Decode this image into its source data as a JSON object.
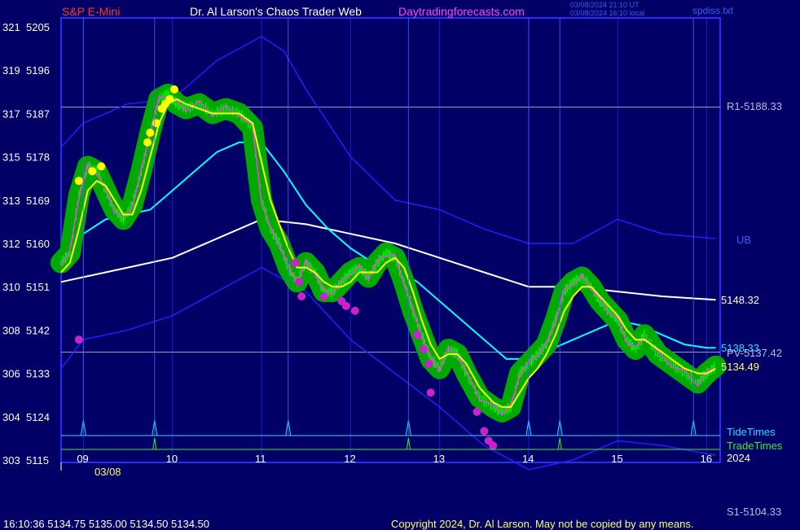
{
  "header": {
    "instrument": "S&P E-Mini",
    "title": "Dr. Al Larson's Chaos Trader Web",
    "site": "Daytradingforecasts.com",
    "utc_time": "03/08/2024 21:10 UT",
    "local_time": "03/08/2024 16:10 local",
    "file": "spdiss.txt"
  },
  "colors": {
    "background": "#000066",
    "frame": "#2a2aff",
    "price": "#00ff00",
    "glow": "#00aa00",
    "ema_fast": "#ffff00",
    "ema_mid": "#00ffff",
    "ema_slow": "#ffffff",
    "bands": "#2020ff",
    "magenta": "#ff33ff",
    "pivot_line": "#9999cc"
  },
  "chart_data": {
    "type": "line",
    "y_left_ticks": [
      "321",
      "319",
      "317",
      "315",
      "313",
      "312",
      "310",
      "308",
      "306",
      "304",
      "303"
    ],
    "y_right_ticks": [
      "5205",
      "5196",
      "5187",
      "5178",
      "5169",
      "5160",
      "5151",
      "5142",
      "5133",
      "5124",
      "5115"
    ],
    "ylim": [
      5115,
      5205
    ],
    "x_ticks": [
      "09",
      "10",
      "11",
      "12",
      "13",
      "14",
      "15",
      "16"
    ],
    "date_label": "03/08",
    "levels": [
      {
        "name": "R1",
        "label": "R1-5188.33",
        "value": 5188.33
      },
      {
        "name": "PV",
        "label": "PV-5137.42",
        "value": 5137.42
      },
      {
        "name": "S1",
        "label": "S1-5104.33",
        "value": 5104.33
      }
    ],
    "right_labels": {
      "ub": "UB",
      "slow_ema": "5148.32",
      "mid_ema": "5138.33",
      "last": "5134.49",
      "tide": "TideTimes",
      "trade": "TradeTimes",
      "year": "2024"
    },
    "x_range": [
      8.75,
      16.15
    ],
    "series": [
      {
        "kind": "price",
        "x": [
          8.75,
          8.85,
          8.95,
          9.05,
          9.15,
          9.25,
          9.35,
          9.45,
          9.55,
          9.65,
          9.75,
          9.85,
          9.95,
          10.05,
          10.15,
          10.3,
          10.45,
          10.6,
          10.75,
          10.9,
          11.0,
          11.1,
          11.2,
          11.3,
          11.4,
          11.5,
          11.6,
          11.7,
          11.8,
          11.9,
          12.0,
          12.1,
          12.2,
          12.3,
          12.4,
          12.5,
          12.6,
          12.7,
          12.8,
          12.9,
          13.0,
          13.1,
          13.2,
          13.3,
          13.45,
          13.6,
          13.7,
          13.8,
          13.9,
          14.0,
          14.1,
          14.2,
          14.3,
          14.4,
          14.5,
          14.6,
          14.7,
          14.8,
          14.9,
          15.0,
          15.1,
          15.2,
          15.3,
          15.45,
          15.6,
          15.75,
          15.9,
          16.0,
          16.1
        ],
        "y": [
          5156,
          5158,
          5170,
          5176,
          5175,
          5171,
          5167,
          5165,
          5168,
          5175,
          5183,
          5190,
          5191,
          5189,
          5188,
          5189,
          5187,
          5188,
          5187,
          5184,
          5169,
          5163,
          5160,
          5155,
          5152,
          5156,
          5154,
          5150,
          5150,
          5152,
          5154,
          5155,
          5153,
          5156,
          5158,
          5157,
          5152,
          5146,
          5141,
          5136,
          5134,
          5138,
          5137,
          5133,
          5128,
          5126,
          5125,
          5126,
          5133,
          5135,
          5137,
          5139,
          5144,
          5150,
          5152,
          5153,
          5151,
          5148,
          5146,
          5144,
          5140,
          5138,
          5141,
          5137,
          5135,
          5133,
          5131,
          5133,
          5134.5
        ]
      },
      {
        "kind": "ema_fast",
        "x": [
          8.75,
          8.85,
          8.95,
          9.05,
          9.15,
          9.25,
          9.35,
          9.45,
          9.55,
          9.65,
          9.75,
          9.85,
          9.95,
          10.05,
          10.15,
          10.3,
          10.45,
          10.6,
          10.75,
          10.9,
          11.0,
          11.1,
          11.2,
          11.3,
          11.4,
          11.5,
          11.6,
          11.7,
          11.8,
          11.9,
          12.0,
          12.1,
          12.2,
          12.3,
          12.4,
          12.5,
          12.6,
          12.7,
          12.8,
          12.9,
          13.0,
          13.1,
          13.2,
          13.3,
          13.45,
          13.6,
          13.7,
          13.8,
          13.9,
          14.0,
          14.1,
          14.2,
          14.3,
          14.4,
          14.5,
          14.6,
          14.7,
          14.8,
          14.9,
          15.0,
          15.1,
          15.2,
          15.3,
          15.45,
          15.6,
          15.75,
          15.9,
          16.0,
          16.1
        ],
        "y": [
          5154,
          5156,
          5163,
          5171,
          5173,
          5172,
          5169,
          5166,
          5166,
          5171,
          5178,
          5185,
          5189,
          5190,
          5189,
          5188,
          5187,
          5187,
          5187,
          5185,
          5177,
          5169,
          5164,
          5159,
          5155,
          5155,
          5154,
          5152,
          5151,
          5151,
          5152,
          5154,
          5154,
          5154,
          5156,
          5157,
          5155,
          5150,
          5144,
          5139,
          5136,
          5137,
          5137,
          5135,
          5130,
          5127,
          5126,
          5126,
          5129,
          5132,
          5134,
          5137,
          5141,
          5146,
          5149,
          5151,
          5151,
          5149,
          5147,
          5145,
          5142,
          5140,
          5140,
          5138,
          5136,
          5134,
          5133,
          5133,
          5134
        ]
      },
      {
        "kind": "ema_mid",
        "x": [
          8.75,
          9.0,
          9.25,
          9.5,
          9.75,
          10.0,
          10.25,
          10.5,
          10.75,
          11.0,
          11.25,
          11.5,
          11.75,
          12.0,
          12.25,
          12.5,
          12.75,
          13.0,
          13.25,
          13.5,
          13.75,
          14.0,
          14.25,
          14.5,
          14.75,
          15.0,
          15.25,
          15.5,
          15.75,
          16.0,
          16.1
        ],
        "y": [
          5158,
          5162,
          5165,
          5166,
          5167,
          5171,
          5175,
          5179,
          5181,
          5181,
          5175,
          5168,
          5163,
          5159,
          5156,
          5155,
          5152,
          5148,
          5144,
          5140,
          5136,
          5136,
          5138,
          5140,
          5142,
          5144,
          5143,
          5141,
          5139,
          5138.3,
          5138.3
        ]
      },
      {
        "kind": "ema_slow",
        "x": [
          8.75,
          9.0,
          9.5,
          10.0,
          10.5,
          11.0,
          11.5,
          12.0,
          12.5,
          13.0,
          13.5,
          14.0,
          14.5,
          15.0,
          15.5,
          16.1
        ],
        "y": [
          5152,
          5153,
          5155,
          5157,
          5161,
          5165,
          5164,
          5162,
          5160,
          5157,
          5154,
          5151,
          5151,
          5150,
          5149,
          5148.3
        ]
      },
      {
        "kind": "upper_band",
        "x": [
          8.75,
          9.0,
          9.5,
          10.0,
          10.5,
          11.0,
          11.25,
          11.5,
          12.0,
          12.5,
          13.0,
          13.5,
          14.0,
          14.5,
          15.0,
          15.5,
          16.1
        ],
        "y": [
          5180,
          5185,
          5189,
          5190,
          5198,
          5203,
          5200,
          5192,
          5178,
          5169,
          5167,
          5163,
          5160,
          5160,
          5165,
          5162,
          5161
        ]
      },
      {
        "kind": "lower_band",
        "x": [
          8.75,
          9.0,
          9.5,
          10.0,
          10.5,
          11.0,
          11.5,
          12.0,
          12.5,
          13.0,
          13.5,
          14.0,
          14.5,
          15.0,
          15.5,
          16.1
        ],
        "y": [
          5134,
          5140,
          5142,
          5145,
          5150,
          5155,
          5150,
          5140,
          5133,
          5126,
          5118,
          5113,
          5115,
          5119,
          5118,
          5116
        ]
      }
    ],
    "yellow_dots": [
      [
        8.95,
        5173
      ],
      [
        9.1,
        5175
      ],
      [
        9.2,
        5176
      ],
      [
        9.72,
        5181
      ],
      [
        9.75,
        5183
      ],
      [
        9.82,
        5185
      ],
      [
        9.88,
        5188
      ],
      [
        9.92,
        5189
      ],
      [
        9.97,
        5190
      ],
      [
        10.02,
        5192
      ]
    ],
    "magenta_dots": [
      [
        8.95,
        5140
      ],
      [
        11.38,
        5156
      ],
      [
        11.42,
        5152
      ],
      [
        11.45,
        5149
      ],
      [
        11.7,
        5149
      ],
      [
        11.9,
        5148
      ],
      [
        11.95,
        5147
      ],
      [
        12.05,
        5146
      ],
      [
        12.75,
        5141
      ],
      [
        12.82,
        5138
      ],
      [
        12.88,
        5135
      ],
      [
        12.9,
        5129
      ],
      [
        13.42,
        5125
      ],
      [
        13.5,
        5121
      ],
      [
        13.55,
        5119
      ],
      [
        13.6,
        5118
      ]
    ],
    "tide_times": [
      9.0,
      9.8,
      11.3,
      12.65,
      14.0,
      14.35,
      15.85
    ],
    "trade_times": [
      9.8,
      12.65,
      14.35
    ]
  },
  "footer": {
    "quote": "16:10:36  5134.75 5135.00 5134.50 5134.50",
    "copyright": "Copyright 2024, Dr. Al Larson. May not be copied by any means."
  }
}
